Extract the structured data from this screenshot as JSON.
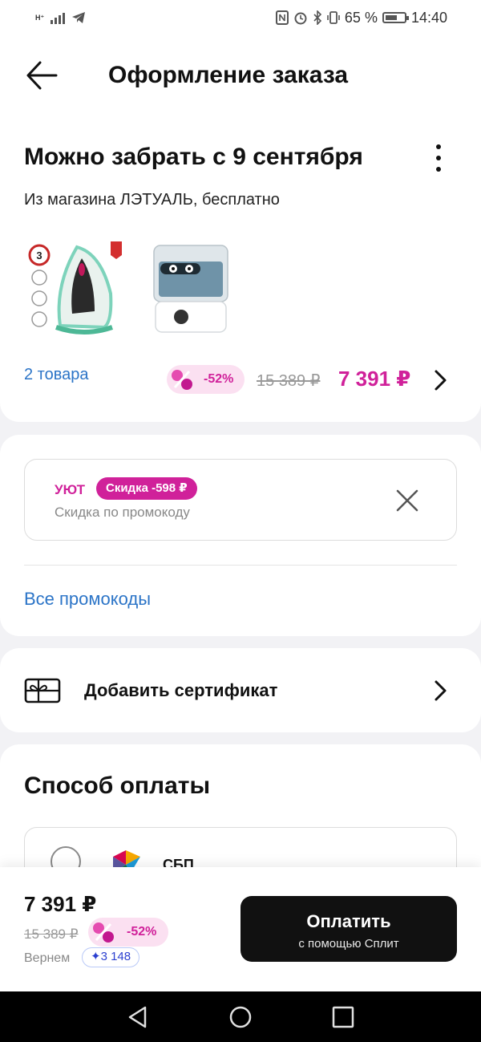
{
  "status_bar": {
    "network": "H⁺",
    "battery_percent": "65 %",
    "battery_level": 0.65,
    "time": "14:40"
  },
  "header": {
    "title": "Оформление заказа"
  },
  "delivery": {
    "title": "Можно забрать с 9 сентября",
    "subtitle": "Из магазина ЛЭТУАЛЬ, бесплатно",
    "items_link": "2 товара",
    "discount": "-52%",
    "old_price": "15 389 ₽",
    "new_price": "7 391 ₽",
    "products": [
      "steam-iron",
      "humidifier"
    ]
  },
  "promo": {
    "code": "УЮТ",
    "badge": "Скидка -598 ₽",
    "description": "Скидка по промокоду",
    "all_link": "Все промокоды"
  },
  "certificate": {
    "label": "Добавить сертификат"
  },
  "payment": {
    "title": "Способ оплаты",
    "option_label": "СБП"
  },
  "bottom": {
    "total": "7 391 ₽",
    "old_total": "15 389 ₽",
    "discount": "-52%",
    "cashback_label": "Вернем",
    "cashback_value": "✦3 148",
    "pay_button": "Оплатить",
    "pay_button_sub": "с помощью Сплит"
  },
  "colors": {
    "accent": "#d0219a",
    "link": "#2b74c7",
    "button": "#111111"
  }
}
